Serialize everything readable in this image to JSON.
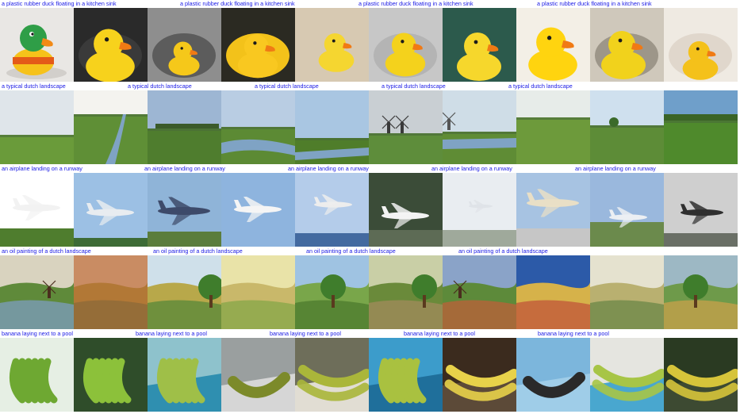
{
  "rows": [
    {
      "caption": "a plastic rubber duck floating in a kitchen sink",
      "caption_count": 4,
      "theme": "duck"
    },
    {
      "caption": "a typical dutch landscape",
      "caption_count": 5,
      "theme": "landscape"
    },
    {
      "caption": "an airplane landing on a runway",
      "caption_count": 5,
      "theme": "airplane"
    },
    {
      "caption": "an oil painting of a dutch landscape",
      "caption_count": 4,
      "theme": "painting"
    },
    {
      "caption": "banana laying next to a pool",
      "caption_count": 5,
      "theme": "banana"
    }
  ],
  "images_per_row": 10,
  "colors": {
    "caption": "#1a1ae6",
    "background": "#ffffff"
  }
}
